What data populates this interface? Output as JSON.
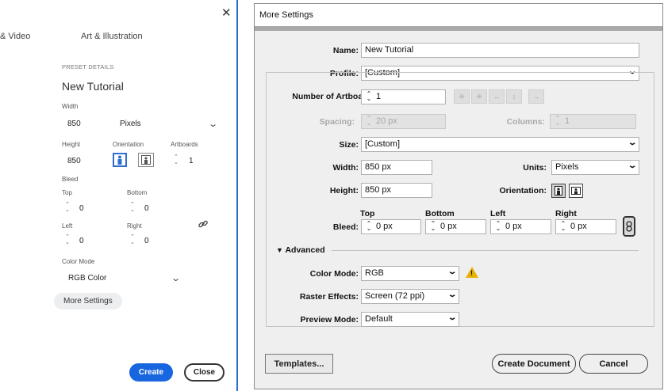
{
  "left_panel": {
    "tabs": [
      "& Video",
      "Art & Illustration"
    ],
    "preset_details_header": "PRESET DETAILS",
    "preset_name": "New Tutorial",
    "width_label": "Width",
    "width_value": "850",
    "units_value": "Pixels",
    "height_label": "Height",
    "height_value": "850",
    "orientation_label": "Orientation",
    "artboards_label": "Artboards",
    "artboards_value": "1",
    "bleed_label": "Bleed",
    "top_label": "Top",
    "top_value": "0",
    "bottom_label": "Bottom",
    "bottom_value": "0",
    "left_label": "Left",
    "left_value": "0",
    "right_label": "Right",
    "right_value": "0",
    "color_mode_label": "Color Mode",
    "color_mode_value": "RGB Color",
    "more_settings": "More Settings",
    "create": "Create",
    "close": "Close",
    "close_glyph": "✕"
  },
  "dialog": {
    "title": "More Settings",
    "name_label": "Name:",
    "name_value": "New Tutorial",
    "profile_label": "Profile:",
    "profile_value": "[Custom]",
    "artboards_label": "Number of Artboards:",
    "artboards_value": "1",
    "spacing_label": "Spacing:",
    "spacing_value": "20 px",
    "columns_label": "Columns:",
    "columns_value": "1",
    "size_label": "Size:",
    "size_value": "[Custom]",
    "width_label": "Width:",
    "width_value": "850 px",
    "units_label": "Units:",
    "units_value": "Pixels",
    "height_label": "Height:",
    "height_value": "850 px",
    "orientation_label": "Orientation:",
    "bleed_label": "Bleed:",
    "bleed_top_label": "Top",
    "bleed_bottom_label": "Bottom",
    "bleed_left_label": "Left",
    "bleed_right_label": "Right",
    "bleed_top_value": "0 px",
    "bleed_bottom_value": "0 px",
    "bleed_left_value": "0 px",
    "bleed_right_value": "0 px",
    "advanced_label": "Advanced",
    "color_mode_label": "Color Mode:",
    "color_mode_value": "RGB",
    "raster_label": "Raster Effects:",
    "raster_value": "Screen (72 ppi)",
    "preview_label": "Preview Mode:",
    "preview_value": "Default",
    "templates_button": "Templates...",
    "create_button": "Create Document",
    "cancel_button": "Cancel"
  },
  "colors": {
    "accent_blue": "#1766e0",
    "warning_yellow": "#e7b200"
  }
}
